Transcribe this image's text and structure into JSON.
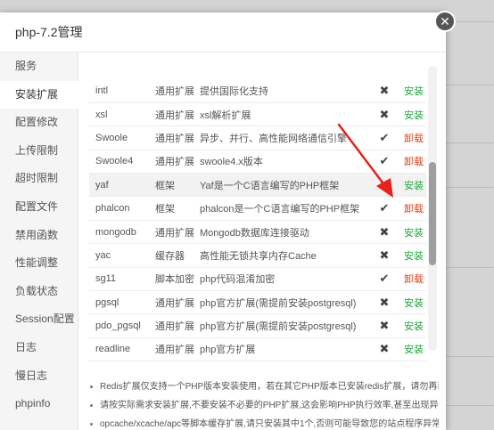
{
  "dialog": {
    "title": "php-7.2管理",
    "close_icon_glyph": "✕"
  },
  "sidebar": {
    "items": [
      {
        "label": "服务"
      },
      {
        "label": "安装扩展"
      },
      {
        "label": "配置修改"
      },
      {
        "label": "上传限制"
      },
      {
        "label": "超时限制"
      },
      {
        "label": "配置文件"
      },
      {
        "label": "禁用函数"
      },
      {
        "label": "性能调整"
      },
      {
        "label": "负载状态"
      },
      {
        "label": "Session配置"
      },
      {
        "label": "日志"
      },
      {
        "label": "慢日志"
      },
      {
        "label": "phpinfo"
      }
    ],
    "active_index": 1
  },
  "extensions": {
    "rows": [
      {
        "name": "intl",
        "type": "通用扩展",
        "desc": "提供国际化支持",
        "status": "✖",
        "action": "安装"
      },
      {
        "name": "xsl",
        "type": "通用扩展",
        "desc": "xsl解析扩展",
        "status": "✖",
        "action": "安装"
      },
      {
        "name": "Swoole",
        "type": "通用扩展",
        "desc": "异步、并行、高性能网络通信引擎",
        "status": "✔",
        "action": "卸载"
      },
      {
        "name": "Swoole4",
        "type": "通用扩展",
        "desc": "swoole4.x版本",
        "status": "✔",
        "action": "卸载"
      },
      {
        "name": "yaf",
        "type": "框架",
        "desc": "Yaf是一个C语言编写的PHP框架",
        "status": "✖",
        "action": "安装"
      },
      {
        "name": "phalcon",
        "type": "框架",
        "desc": "phalcon是一个C语言编写的PHP框架",
        "status": "✔",
        "action": "卸载"
      },
      {
        "name": "mongodb",
        "type": "通用扩展",
        "desc": "Mongodb数据库连接驱动",
        "status": "✖",
        "action": "安装"
      },
      {
        "name": "yac",
        "type": "缓存器",
        "desc": "高性能无锁共享内存Cache",
        "status": "✖",
        "action": "安装"
      },
      {
        "name": "sg11",
        "type": "脚本加密",
        "desc": "php代码混淆加密",
        "status": "✔",
        "action": "卸载"
      },
      {
        "name": "pgsql",
        "type": "通用扩展",
        "desc": "php官方扩展(需提前安装postgresql)",
        "status": "✖",
        "action": "安装"
      },
      {
        "name": "pdo_pgsql",
        "type": "通用扩展",
        "desc": "php官方扩展(需提前安装postgresql)",
        "status": "✖",
        "action": "安装"
      },
      {
        "name": "readline",
        "type": "通用扩展",
        "desc": "php官方扩展",
        "status": "✖",
        "action": "安装"
      }
    ],
    "highlight_index": 4
  },
  "notes": [
    "Redis扩展仅支持一个PHP版本安装使用，若在其它PHP版本已安装redis扩展，请勿再装",
    "请按实际需求安装扩展,不要安装不必要的PHP扩展,这会影响PHP执行效率,甚至出现异常",
    "opcache/xcache/apc等脚本缓存扩展,请只安装其中1个,否则可能导致您的站点程序异常"
  ],
  "colors": {
    "install": "#20a53a",
    "uninstall": "#e0421c",
    "annotation_arrow": "#e8211b"
  },
  "icons": {
    "installed": "check-icon",
    "not_installed": "cross-icon",
    "close": "close-icon"
  }
}
